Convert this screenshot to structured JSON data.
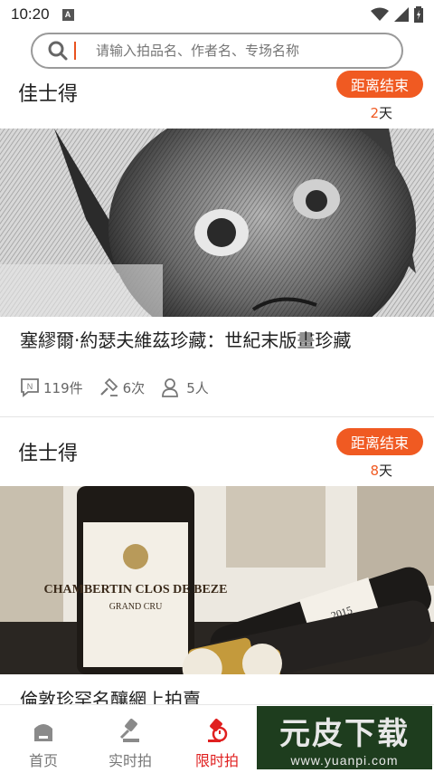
{
  "status_bar": {
    "time": "10:20",
    "notification_icon": "A"
  },
  "search": {
    "placeholder": "请输入拍品名、作者名、专场名称"
  },
  "cards": [
    {
      "house": "佳士得",
      "countdown_label": "距离结束",
      "days_value": "2",
      "days_unit": "天",
      "image_subject": "etching-face",
      "title": "塞繆爾·約瑟夫維茲珍藏：世紀末版畫珍藏",
      "stats": {
        "lots": "119件",
        "bids": "6次",
        "participants": "5人"
      }
    },
    {
      "house": "佳士得",
      "countdown_label": "距离结束",
      "days_value": "8",
      "days_unit": "天",
      "image_subject": "wine-bottles",
      "title": "倫敦珍罕名釀網上拍賣",
      "label_text": {
        "brand": "CHAMBERTIN CLOS DE BEZE",
        "grade": "GRAND CRU",
        "year": "2015"
      }
    }
  ],
  "tab_bar": {
    "tabs": [
      {
        "label": "首页",
        "icon": "home-icon"
      },
      {
        "label": "实时拍",
        "icon": "gavel-icon"
      },
      {
        "label": "限时拍",
        "icon": "timed-auction-icon",
        "active": true
      }
    ]
  },
  "watermark": {
    "title": "元皮下载",
    "url": "www.yuanpi.com"
  },
  "colors": {
    "accent": "#f05a22",
    "active_tab": "#e02020",
    "text": "#222222",
    "muted": "#666666"
  }
}
